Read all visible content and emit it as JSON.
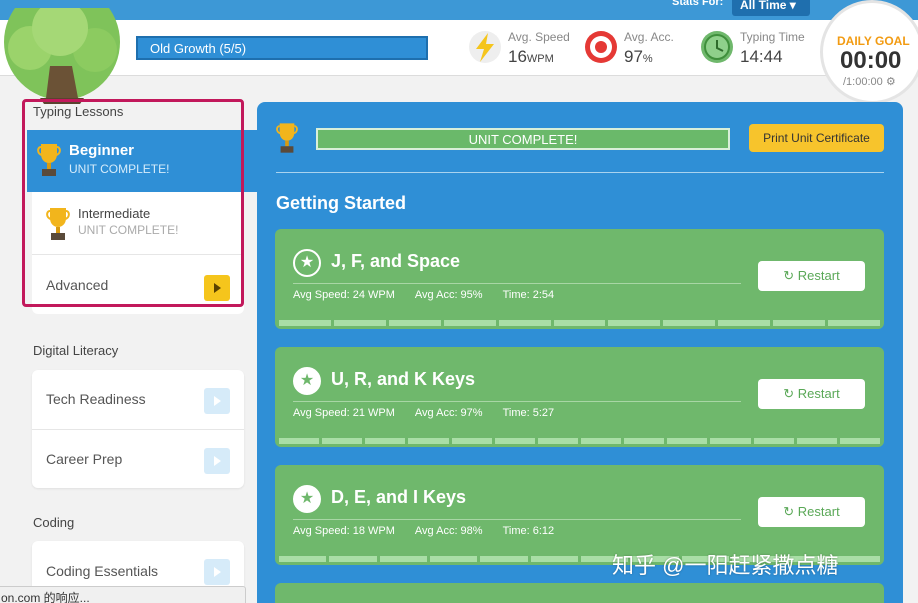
{
  "top": {
    "stats_label": "Stats For:",
    "stats_value": "All Time ▾"
  },
  "header": {
    "level_name": "Old Growth (5/5)",
    "stats": [
      {
        "label": "Avg. Speed",
        "value": "16",
        "unit": "WPM",
        "icon": "lightning-icon"
      },
      {
        "label": "Avg. Acc.",
        "value": "97",
        "unit": "%",
        "icon": "target-icon"
      },
      {
        "label": "Typing Time",
        "value": "14:44",
        "unit": "",
        "icon": "clock-icon"
      }
    ],
    "daily_goal": {
      "label": "DAILY GOAL",
      "time": "00:00",
      "target": "/1:00:00 ⚙"
    }
  },
  "sidebar": {
    "typing_title": "Typing Lessons",
    "typing": [
      {
        "name": "Beginner",
        "status": "UNIT COMPLETE!"
      },
      {
        "name": "Intermediate",
        "status": "UNIT COMPLETE!"
      },
      {
        "name": "Advanced"
      }
    ],
    "digital_title": "Digital Literacy",
    "digital": [
      {
        "name": "Tech Readiness"
      },
      {
        "name": "Career Prep"
      }
    ],
    "coding_title": "Coding",
    "coding": [
      {
        "name": "Coding Essentials"
      }
    ]
  },
  "status_popup": "on.com 的响应...",
  "main": {
    "unit_status": "UNIT COMPLETE!",
    "certificate_button": "Print Unit Certificate",
    "section_title": "Getting Started",
    "lessons": [
      {
        "title": "J, F, and Space",
        "speed": "Avg Speed: 24 WPM",
        "acc": "Avg Acc: 95%",
        "time": "Time: 2:54",
        "restart": "Restart",
        "segments": 11
      },
      {
        "title": "U, R, and K Keys",
        "speed": "Avg Speed: 21 WPM",
        "acc": "Avg Acc: 97%",
        "time": "Time: 5:27",
        "restart": "Restart",
        "segments": 14
      },
      {
        "title": "D, E, and I Keys",
        "speed": "Avg Speed: 18 WPM",
        "acc": "Avg Acc: 98%",
        "time": "Time: 6:12",
        "restart": "Restart",
        "segments": 12
      }
    ]
  },
  "watermark": "知乎 @一阳赶紧撒点糖",
  "colors": {
    "brand_blue": "#2f8fd6",
    "lesson_green": "#6fb86c",
    "accent_yellow": "#f7c42c",
    "highlight": "#c2185b"
  }
}
